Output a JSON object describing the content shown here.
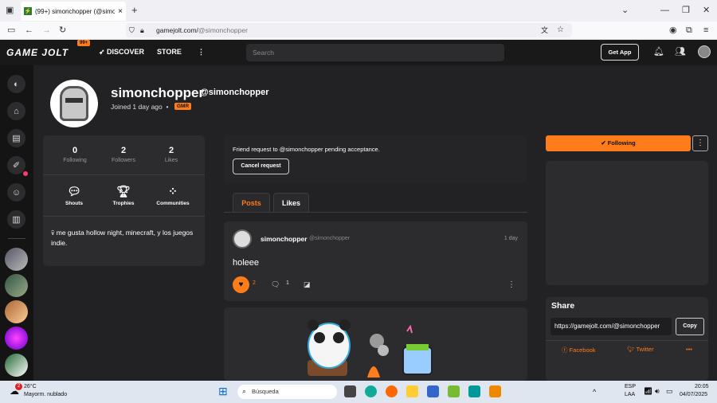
{
  "browser": {
    "tab_title": "(99+) simonchopper (@simonc",
    "tab_close": "×",
    "new_tab": "+",
    "url_domain": "gamejolt.com/",
    "url_path": "@simonchopper"
  },
  "site": {
    "logo": "GAME JOLT",
    "notif_badge": "99+",
    "nav_discover": "DISCOVER",
    "nav_store": "STORE",
    "search_placeholder": "Search",
    "get_app": "Get App"
  },
  "profile": {
    "name": "simonchopper",
    "handle": "@simonchopper",
    "joined": "Joined 1 day ago",
    "dot": "•",
    "badge": "GMR",
    "stats": [
      {
        "n": "0",
        "l": "Following"
      },
      {
        "n": "2",
        "l": "Followers"
      },
      {
        "n": "2",
        "l": "Likes"
      }
    ],
    "features": [
      {
        "l": "Shouts"
      },
      {
        "l": "Trophies"
      },
      {
        "l": "Communities"
      }
    ],
    "bio": "me gusta hollow night, minecraft, y los juegos indie."
  },
  "notice": {
    "text": "Friend request to @simonchopper pending acceptance.",
    "cancel": "Cancel request"
  },
  "tabs": {
    "posts": "Posts",
    "likes": "Likes"
  },
  "post": {
    "user": "simonchopper",
    "handle": "@simonchopper",
    "date": "1 day",
    "body": "holeee",
    "likes": "2",
    "comments": "1"
  },
  "right": {
    "following": "Following",
    "share_title": "Share",
    "share_url": "https://gamejolt.com/@simonchopper",
    "copy": "Copy",
    "facebook": "Facebook",
    "twitter": "Twitter",
    "more": "•••"
  },
  "taskbar": {
    "weather_temp": "26°C",
    "weather_desc": "Mayorm. nublado",
    "weather_badge": "2",
    "search": "Búsqueda",
    "lang1": "ESP",
    "lang2": "LAA",
    "time": "20:05",
    "date": "04/07/2025"
  },
  "colors": {
    "accent": "#ff7c1a",
    "bg": "#222123",
    "card": "#2c2b2d"
  }
}
